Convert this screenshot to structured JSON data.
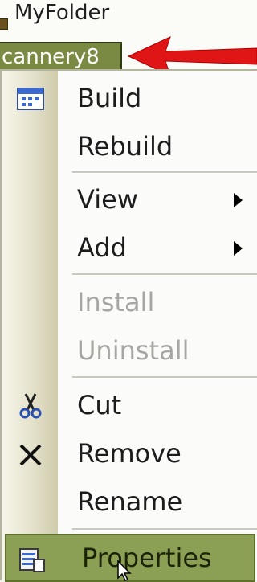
{
  "tree": {
    "folder_label": "MyFolder",
    "node_label": "cannery8"
  },
  "menu": {
    "items": [
      {
        "label": "Build",
        "enabled": true,
        "icon": "build-icon"
      },
      {
        "label": "Rebuild",
        "enabled": true
      },
      {
        "label": "View",
        "enabled": true,
        "submenu": true
      },
      {
        "label": "Add",
        "enabled": true,
        "submenu": true
      },
      {
        "label": "Install",
        "enabled": false
      },
      {
        "label": "Uninstall",
        "enabled": false
      },
      {
        "label": "Cut",
        "enabled": true,
        "icon": "scissors-icon"
      },
      {
        "label": "Remove",
        "enabled": true,
        "icon": "close-icon"
      },
      {
        "label": "Rename",
        "enabled": true
      },
      {
        "label": "Properties",
        "enabled": true,
        "icon": "properties-icon",
        "selected": true
      }
    ]
  },
  "colors": {
    "highlight": "#8ba054",
    "arrow": "#e01616"
  }
}
